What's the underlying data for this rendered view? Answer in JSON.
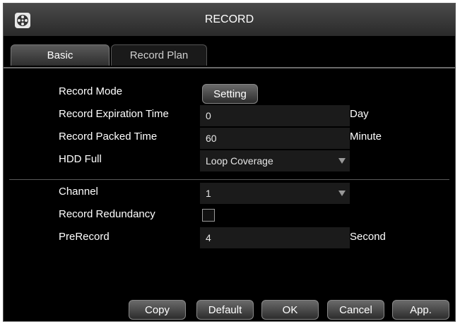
{
  "window": {
    "title": "RECORD",
    "app_icon": "film-reel-icon"
  },
  "tabs": [
    {
      "label": "Basic",
      "active": true
    },
    {
      "label": "Record Plan",
      "active": false
    }
  ],
  "form": {
    "record_mode": {
      "label": "Record Mode",
      "button_label": "Setting"
    },
    "expiration": {
      "label": "Record Expiration Time",
      "value": "0",
      "unit": "Day"
    },
    "packed_time": {
      "label": "Record Packed Time",
      "value": "60",
      "unit": "Minute"
    },
    "hdd_full": {
      "label": "HDD Full",
      "value": "Loop Coverage"
    },
    "channel": {
      "label": "Channel",
      "value": "1"
    },
    "redundancy": {
      "label": "Record Redundancy",
      "checked": false
    },
    "prerecord": {
      "label": "PreRecord",
      "value": "4",
      "unit": "Second"
    }
  },
  "footer": {
    "copy": "Copy",
    "default": "Default",
    "ok": "OK",
    "cancel": "Cancel",
    "apply": "App."
  },
  "colors": {
    "background": "#000000",
    "field": "#1b1b1b",
    "text": "#ffffff"
  }
}
